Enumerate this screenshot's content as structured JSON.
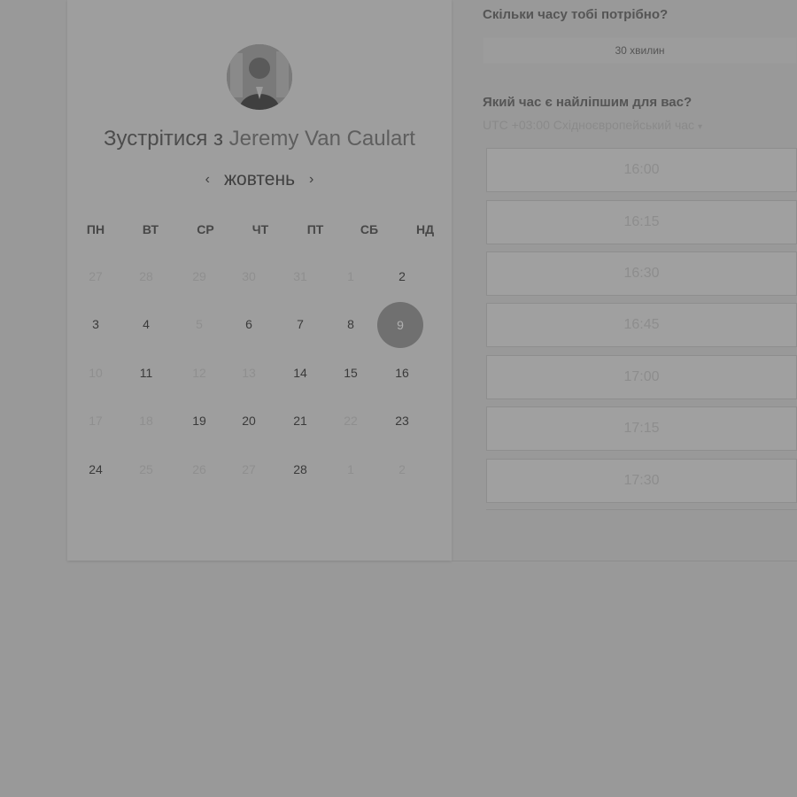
{
  "organizer": {
    "title_prefix": "Зустрітися з",
    "name": "Jeremy Van Caulart",
    "avatar_icon": "person-avatar"
  },
  "calendar": {
    "month": "жовтень",
    "prev_icon": "chevron-left-icon",
    "next_icon": "chevron-right-icon",
    "weekdays": [
      "ПН",
      "ВТ",
      "СР",
      "ЧТ",
      "ПТ",
      "СБ",
      "НД"
    ],
    "weeks": [
      [
        {
          "d": "27",
          "off": true
        },
        {
          "d": "28",
          "off": true
        },
        {
          "d": "29",
          "off": true
        },
        {
          "d": "30",
          "off": true
        },
        {
          "d": "31",
          "off": true
        },
        {
          "d": "1",
          "off": true
        },
        {
          "d": "2",
          "off": false
        }
      ],
      [
        {
          "d": "3",
          "off": false
        },
        {
          "d": "4",
          "off": false
        },
        {
          "d": "5",
          "off": true
        },
        {
          "d": "6",
          "off": false
        },
        {
          "d": "7",
          "off": false
        },
        {
          "d": "8",
          "off": false
        },
        {
          "d": "9",
          "off": false,
          "selected": true
        }
      ],
      [
        {
          "d": "10",
          "off": true
        },
        {
          "d": "11",
          "off": false
        },
        {
          "d": "12",
          "off": true
        },
        {
          "d": "13",
          "off": true
        },
        {
          "d": "14",
          "off": false
        },
        {
          "d": "15",
          "off": false
        },
        {
          "d": "16",
          "off": false
        }
      ],
      [
        {
          "d": "17",
          "off": true
        },
        {
          "d": "18",
          "off": true
        },
        {
          "d": "19",
          "off": false
        },
        {
          "d": "20",
          "off": false
        },
        {
          "d": "21",
          "off": false
        },
        {
          "d": "22",
          "off": true
        },
        {
          "d": "23",
          "off": false
        }
      ],
      [
        {
          "d": "24",
          "off": false
        },
        {
          "d": "25",
          "off": true
        },
        {
          "d": "26",
          "off": true
        },
        {
          "d": "27",
          "off": true
        },
        {
          "d": "28",
          "off": false
        },
        {
          "d": "1",
          "off": true
        },
        {
          "d": "2",
          "off": true
        }
      ]
    ]
  },
  "duration": {
    "question": "Скільки часу тобі потрібно?",
    "value": "30 хвилин"
  },
  "time_pick": {
    "question": "Який час є найліпшим для вас?",
    "timezone": "UTC +03:00 Східноєвропейський час",
    "slots": [
      "16:00",
      "16:15",
      "16:30",
      "16:45",
      "17:00",
      "17:15",
      "17:30"
    ]
  },
  "colors": {
    "overlay": "#999999",
    "selected_day": "#707070"
  }
}
